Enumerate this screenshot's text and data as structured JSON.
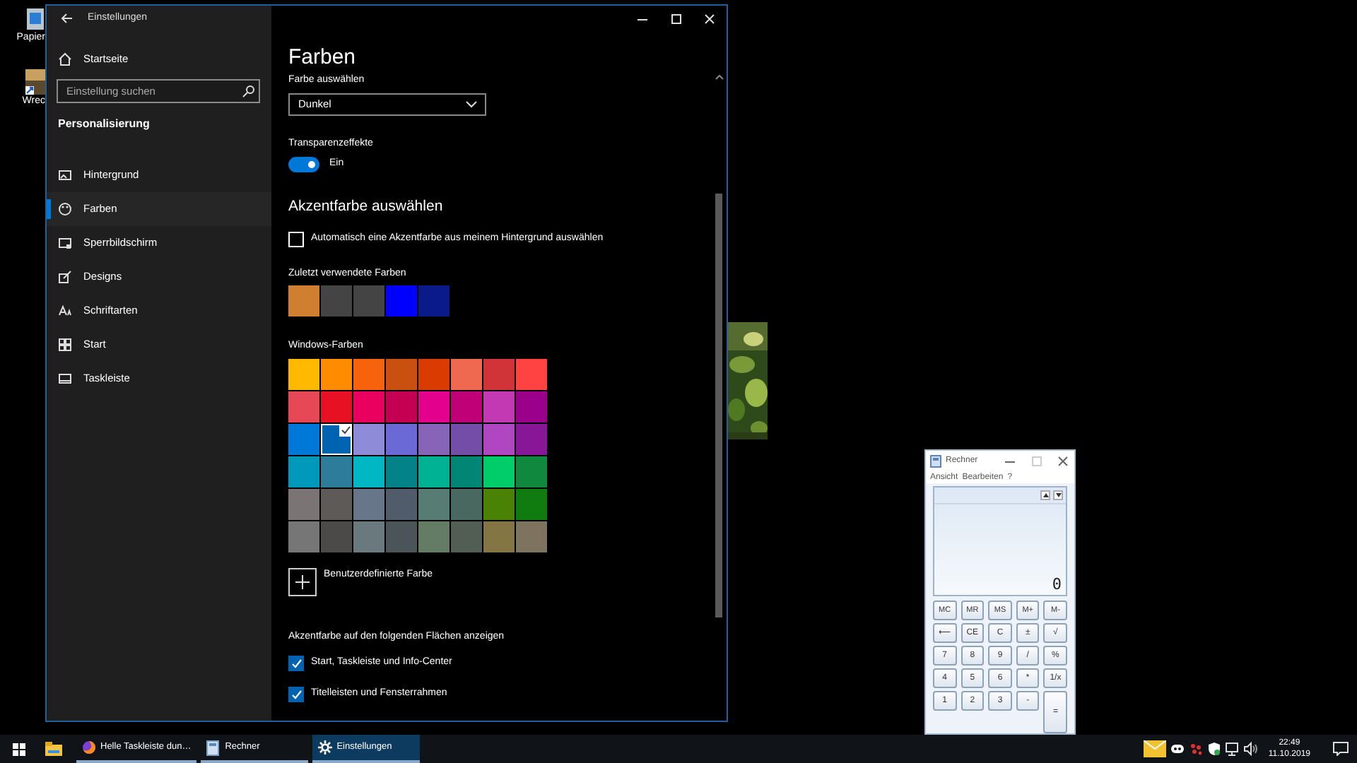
{
  "desktop_icons": [
    {
      "label": "Papier"
    },
    {
      "label": "Wrec"
    }
  ],
  "settings": {
    "title": "Einstellungen",
    "home": "Startseite",
    "search": {
      "placeholder": "Einstellung suchen"
    },
    "section": "Personalisierung",
    "nav": [
      {
        "label": "Hintergrund",
        "selected": false
      },
      {
        "label": "Farben",
        "selected": true
      },
      {
        "label": "Sperrbildschirm",
        "selected": false
      },
      {
        "label": "Designs",
        "selected": false
      },
      {
        "label": "Schriftarten",
        "selected": false
      },
      {
        "label": "Start",
        "selected": false
      },
      {
        "label": "Taskleiste",
        "selected": false
      }
    ],
    "page_title": "Farben",
    "mode": {
      "label": "Farbe auswählen",
      "value": "Dunkel"
    },
    "transparency": {
      "label": "Transparenzeffekte",
      "on": true,
      "state_text": "Ein"
    },
    "accent_heading": "Akzentfarbe auswählen",
    "auto_accent": {
      "label": "Automatisch eine Akzentfarbe aus meinem Hintergrund auswählen",
      "checked": false
    },
    "recent": {
      "label": "Zuletzt verwendete Farben",
      "colors": [
        {
          "color": "#d07f30"
        },
        {
          "color": "#444444"
        },
        {
          "color": "#444444"
        },
        {
          "color": "#0000ff"
        },
        {
          "color": "#0a1a88"
        }
      ]
    },
    "windows_colors": {
      "label": "Windows-Farben",
      "colors": [
        {
          "color": "#ffb900",
          "selected": false
        },
        {
          "color": "#ff8c00",
          "selected": false
        },
        {
          "color": "#f7630c",
          "selected": false
        },
        {
          "color": "#ca5010",
          "selected": false
        },
        {
          "color": "#da3b01",
          "selected": false
        },
        {
          "color": "#ef6950",
          "selected": false
        },
        {
          "color": "#d13438",
          "selected": false
        },
        {
          "color": "#ff4343",
          "selected": false
        },
        {
          "color": "#e74856",
          "selected": false
        },
        {
          "color": "#e81123",
          "selected": false
        },
        {
          "color": "#ea005e",
          "selected": false
        },
        {
          "color": "#c30052",
          "selected": false
        },
        {
          "color": "#e3008c",
          "selected": false
        },
        {
          "color": "#bf0077",
          "selected": false
        },
        {
          "color": "#c239b3",
          "selected": false
        },
        {
          "color": "#9a0089",
          "selected": false
        },
        {
          "color": "#0078d7",
          "selected": false
        },
        {
          "color": "#0063b1",
          "selected": true
        },
        {
          "color": "#8e8cd8",
          "selected": false
        },
        {
          "color": "#6b69d6",
          "selected": false
        },
        {
          "color": "#8764b8",
          "selected": false
        },
        {
          "color": "#744da9",
          "selected": false
        },
        {
          "color": "#b146c2",
          "selected": false
        },
        {
          "color": "#881798",
          "selected": false
        },
        {
          "color": "#0099bc",
          "selected": false
        },
        {
          "color": "#2d7d9a",
          "selected": false
        },
        {
          "color": "#00b7c3",
          "selected": false
        },
        {
          "color": "#038387",
          "selected": false
        },
        {
          "color": "#00b294",
          "selected": false
        },
        {
          "color": "#018574",
          "selected": false
        },
        {
          "color": "#00cc6a",
          "selected": false
        },
        {
          "color": "#10893e",
          "selected": false
        },
        {
          "color": "#7a7574",
          "selected": false
        },
        {
          "color": "#5d5a58",
          "selected": false
        },
        {
          "color": "#68768a",
          "selected": false
        },
        {
          "color": "#515c6b",
          "selected": false
        },
        {
          "color": "#567c73",
          "selected": false
        },
        {
          "color": "#486860",
          "selected": false
        },
        {
          "color": "#498205",
          "selected": false
        },
        {
          "color": "#107c10",
          "selected": false
        },
        {
          "color": "#767676",
          "selected": false
        },
        {
          "color": "#4c4a48",
          "selected": false
        },
        {
          "color": "#69797e",
          "selected": false
        },
        {
          "color": "#4a5459",
          "selected": false
        },
        {
          "color": "#647c64",
          "selected": false
        },
        {
          "color": "#525e54",
          "selected": false
        },
        {
          "color": "#847545",
          "selected": false
        },
        {
          "color": "#7e735f",
          "selected": false
        }
      ]
    },
    "custom_color": "Benutzerdefinierte Farbe",
    "surfaces": {
      "label": "Akzentfarbe auf den folgenden Flächen anzeigen",
      "options": [
        {
          "label": "Start, Taskleiste und Info-Center",
          "checked": true
        },
        {
          "label": "Titelleisten und Fensterrahmen",
          "checked": true
        }
      ]
    }
  },
  "calculator": {
    "title": "Rechner",
    "menu": [
      "Ansicht",
      "Bearbeiten",
      "?"
    ],
    "display": "0",
    "keys": [
      {
        "label": "MC",
        "kind": "memory"
      },
      {
        "label": "MR",
        "kind": "memory"
      },
      {
        "label": "MS",
        "kind": "memory"
      },
      {
        "label": "M+",
        "kind": "memory"
      },
      {
        "label": "M-",
        "kind": "memory"
      },
      {
        "label": "⟵",
        "kind": "function"
      },
      {
        "label": "CE",
        "kind": "function"
      },
      {
        "label": "C",
        "kind": "function"
      },
      {
        "label": "±",
        "kind": "function"
      },
      {
        "label": "√",
        "kind": "function"
      },
      {
        "label": "7",
        "kind": "digit"
      },
      {
        "label": "8",
        "kind": "digit"
      },
      {
        "label": "9",
        "kind": "digit"
      },
      {
        "label": "/",
        "kind": "operator"
      },
      {
        "label": "%",
        "kind": "operator"
      },
      {
        "label": "4",
        "kind": "digit"
      },
      {
        "label": "5",
        "kind": "digit"
      },
      {
        "label": "6",
        "kind": "digit"
      },
      {
        "label": "*",
        "kind": "operator"
      },
      {
        "label": "1/x",
        "kind": "operator"
      },
      {
        "label": "1",
        "kind": "digit"
      },
      {
        "label": "2",
        "kind": "digit"
      },
      {
        "label": "3",
        "kind": "digit"
      },
      {
        "label": "-",
        "kind": "operator"
      },
      {
        "label": "=",
        "kind": "equals"
      }
    ]
  },
  "taskbar": {
    "apps": [
      {
        "kind": "browser",
        "label": "Helle Taskleiste dun…",
        "active": false
      },
      {
        "kind": "calculator",
        "label": "Rechner",
        "active": false
      },
      {
        "kind": "settings",
        "label": "Einstellungen",
        "active": true
      }
    ],
    "clock": {
      "time": "22:49",
      "date": "11.10.2019"
    }
  }
}
